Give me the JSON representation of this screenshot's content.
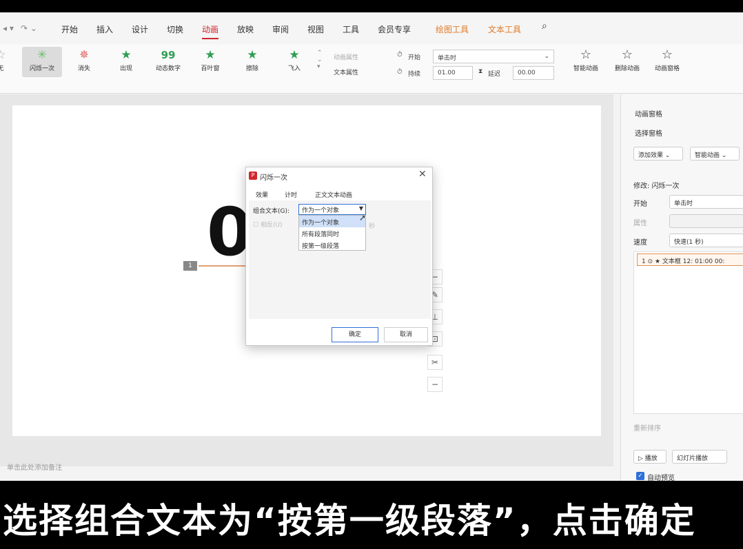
{
  "tabs": [
    "开始",
    "插入",
    "设计",
    "切换",
    "动画",
    "放映",
    "审阅",
    "视图",
    "工具",
    "会员专享",
    "绘图工具",
    "文本工具"
  ],
  "active_tab": "动画",
  "ribbon": {
    "effects": [
      "无",
      "闪烁一次",
      "消失",
      "出现",
      "动态数字",
      "百叶窗",
      "擦除",
      "飞入"
    ],
    "selected_effect": "闪烁一次",
    "anim_props": "动画属性",
    "text_props": "文本属性",
    "start_label": "开始",
    "start_value": "单击时",
    "duration_label": "持续",
    "duration_value": "01.00",
    "delay_label": "延迟",
    "delay_value": "00.00",
    "smart_anim": "智能动画",
    "remove_anim": "删除动画",
    "anim_pane": "动画窗格"
  },
  "slide": {
    "big_text": "0",
    "tag": "1"
  },
  "notes_placeholder": "单击此处添加备注",
  "pane": {
    "title": "动画窗格",
    "select_pane": "选择窗格",
    "add_effect": "添加效果",
    "smart_anim": "智能动画",
    "modify": "修改: 闪烁一次",
    "start_label": "开始",
    "start_value": "单击时",
    "prop_label": "属性",
    "speed_label": "速度",
    "speed_value": "快速(1 秒)",
    "item": "1 ⊙ ★ 文本框 12: 01:00 00:",
    "reorder": "重新排序",
    "play": "播放",
    "slideshow": "幻灯片播放",
    "auto_preview": "自动预览"
  },
  "dialog": {
    "title": "闪烁一次",
    "tabs": [
      "效果",
      "计时",
      "正文文本动画"
    ],
    "combo_label": "组合文本(G):",
    "combo_value": "作为一个对象",
    "options": [
      "作为一个对象",
      "所有段落同时",
      "按第一级段落"
    ],
    "dim_check": "相反(U)",
    "dim_sec": "秒",
    "ok": "确定",
    "cancel": "取消"
  },
  "caption": "选择组合文本为“按第一级段落”，点击确定"
}
